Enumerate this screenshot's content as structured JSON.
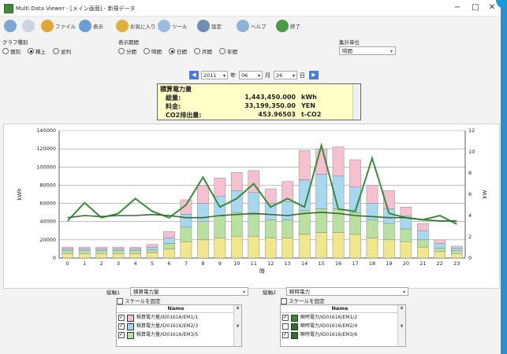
{
  "window": {
    "title": "Multi Data Viewer - [メイン画面] - 新規データ",
    "minimize": "−",
    "maximize": "□",
    "close": "✕"
  },
  "toolbar": {
    "items": [
      {
        "label": "",
        "icon": "back-icon",
        "color": "#7aa7d8"
      },
      {
        "label": "",
        "icon": "forward-icon",
        "color": "#c9d6e6"
      },
      {
        "label": "ファイル",
        "icon": "folder-icon",
        "color": "#e3a534"
      },
      {
        "label": "表示",
        "icon": "view-icon",
        "color": "#6a9fd6"
      },
      {
        "label": "お気に入り",
        "icon": "star-icon",
        "color": "#e0b23c"
      },
      {
        "label": "ツール",
        "icon": "search-icon",
        "color": "#9bbde0"
      },
      {
        "label": "設定",
        "icon": "wrench-icon",
        "color": "#6f8fb8"
      },
      {
        "label": "ヘルプ",
        "icon": "help-icon",
        "color": "#8fb2d8"
      },
      {
        "label": "終了",
        "icon": "exit-icon",
        "color": "#4a9a4a"
      }
    ]
  },
  "controls": {
    "graph_type_label": "グラフ種別",
    "graph_types": [
      {
        "label": "個別",
        "selected": false
      },
      {
        "label": "積上",
        "selected": true
      },
      {
        "label": "並列",
        "selected": false
      }
    ],
    "period_label": "表示期間",
    "periods": [
      {
        "label": "分間",
        "selected": false
      },
      {
        "label": "時間",
        "selected": false
      },
      {
        "label": "日間",
        "selected": true
      },
      {
        "label": "月間",
        "selected": false
      },
      {
        "label": "年間",
        "selected": false
      }
    ],
    "unit_label": "集計単位",
    "unit_value": "時間"
  },
  "date_nav": {
    "prev": "◀",
    "next": "▶",
    "year": "2011",
    "year_label": "年",
    "month": "06",
    "month_label": "月",
    "day": "26",
    "day_label": "日"
  },
  "summary": {
    "title": "積算電力量",
    "rows": [
      {
        "label": "総量:",
        "value": "1,443,450.000",
        "unit": "kWh"
      },
      {
        "label": "料金:",
        "value": "33,199,350.00",
        "unit": "YEN"
      },
      {
        "label": "CO2排出量:",
        "value": "453.96503",
        "unit": "t-CO2"
      }
    ]
  },
  "chart_data": {
    "type": "bar",
    "stacked": true,
    "categories": [
      "0",
      "1",
      "2",
      "3",
      "4",
      "5",
      "6",
      "7",
      "8",
      "9",
      "10",
      "11",
      "12",
      "13",
      "14",
      "15",
      "16",
      "17",
      "18",
      "19",
      "20",
      "21",
      "22",
      "23"
    ],
    "xlabel": "時",
    "ylabel": "kWh",
    "y2label": "kW",
    "ylim": [
      0,
      140000
    ],
    "y2lim": [
      0,
      12
    ],
    "yticks": [
      0,
      20000,
      40000,
      60000,
      80000,
      100000,
      120000,
      140000
    ],
    "y2ticks": [
      0,
      2,
      4,
      6,
      8,
      10,
      12
    ],
    "grid": true,
    "series": [
      {
        "name": "積算電力量/ID01616/EM1/1",
        "color": "#f0e68c",
        "values": [
          5000,
          5000,
          5000,
          5000,
          5000,
          6000,
          10000,
          18000,
          20000,
          22000,
          24000,
          24000,
          22000,
          22000,
          26000,
          28000,
          28000,
          26000,
          22000,
          20000,
          18000,
          12000,
          7000,
          5000
        ]
      },
      {
        "name": "",
        "color": "#b8e0a0",
        "values": [
          3000,
          3000,
          3000,
          3000,
          3000,
          3000,
          6000,
          16000,
          20000,
          24000,
          26000,
          24000,
          20000,
          20000,
          26000,
          26000,
          26000,
          24000,
          20000,
          18000,
          14000,
          8000,
          4000,
          3000
        ]
      },
      {
        "name": "積算電力量/ID01616/EM2/3",
        "color": "#a8d8f0",
        "values": [
          2000,
          2000,
          2000,
          2000,
          2000,
          3000,
          6000,
          14000,
          20000,
          22000,
          24000,
          24000,
          18000,
          20000,
          34000,
          38000,
          36000,
          28000,
          18000,
          16000,
          14000,
          10000,
          5000,
          3000
        ]
      },
      {
        "name": "",
        "color": "#f5c0d0",
        "values": [
          2000,
          2000,
          2000,
          2000,
          2000,
          3000,
          7000,
          16000,
          20000,
          20000,
          20000,
          24000,
          16000,
          22000,
          32000,
          28000,
          32000,
          30000,
          20000,
          20000,
          10000,
          8000,
          4000,
          2000
        ]
      }
    ],
    "lines": [
      {
        "name": "瞬時電力/ID01616/EM1/2",
        "color": "#3b8a3b",
        "values": [
          3.5,
          5.2,
          3.8,
          4.2,
          5.6,
          4.4,
          3.8,
          5.0,
          7.6,
          4.8,
          5.6,
          7.0,
          4.8,
          5.6,
          4.8,
          10.6,
          4.6,
          4.4,
          9.4,
          4.2,
          3.8,
          3.6,
          4.0,
          3.2
        ]
      },
      {
        "name": "瞬時電力/ID01616/EM2/4",
        "color": "#2f6e2f",
        "values": [
          3.8,
          4.0,
          3.9,
          4.0,
          4.0,
          4.1,
          4.0,
          3.8,
          3.8,
          4.0,
          4.1,
          4.2,
          4.1,
          4.0,
          4.2,
          4.3,
          4.2,
          4.0,
          3.9,
          3.8,
          3.8,
          3.6,
          3.5,
          3.5
        ]
      }
    ]
  },
  "bottom": {
    "axis1_label": "縦軸1",
    "axis1_value": "積算電力量",
    "axis1_fix": "スケールを固定",
    "axis2_label": "縦軸2",
    "axis2_value": "瞬時電力",
    "axis2_fix": "スケールを固定",
    "list_header": "Name",
    "list1": [
      {
        "name": "積算電力量/ID01616/EM1/1",
        "color": "#f5c0d0",
        "checked": true
      },
      {
        "name": "積算電力量/ID01616/EM2/3",
        "color": "#a8d8f0",
        "checked": true
      },
      {
        "name": "積算電力量/ID01616/EM3/5",
        "color": "#b8e0a0",
        "checked": true
      }
    ],
    "list2": [
      {
        "name": "瞬時電力/ID01616/EM1/2",
        "color": "#3b8a3b",
        "checked": true
      },
      {
        "name": "瞬時電力/ID01616/EM2/4",
        "color": "#2f6e2f",
        "checked": false
      },
      {
        "name": "瞬時電力/ID01616/EM3/6",
        "color": "#2f6e2f",
        "checked": true
      }
    ]
  }
}
